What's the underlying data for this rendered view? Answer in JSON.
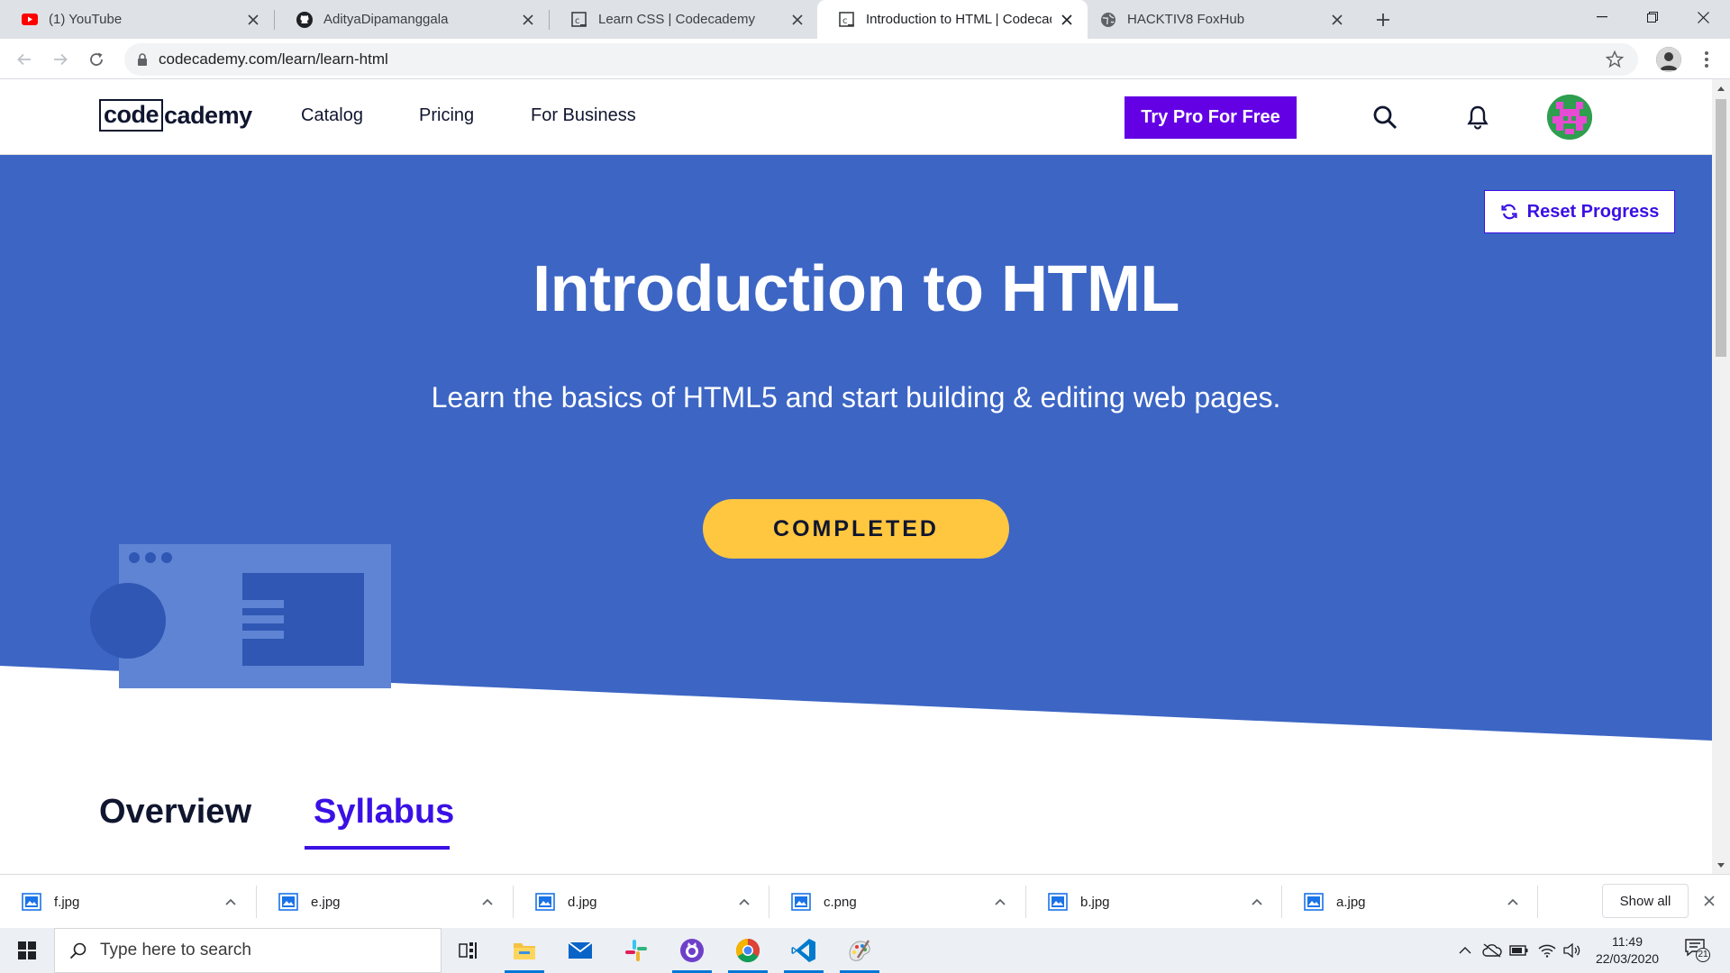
{
  "browser": {
    "tabs": [
      {
        "title": "(1) YouTube",
        "icon": "youtube-icon",
        "active": false
      },
      {
        "title": "AdityaDipamanggala",
        "icon": "github-icon",
        "active": false
      },
      {
        "title": "Learn CSS | Codecademy",
        "icon": "codecademy-icon",
        "active": false
      },
      {
        "title": "Introduction to HTML | Codecademy",
        "icon": "codecademy-icon",
        "active": true
      },
      {
        "title": "HACKTIV8 FoxHub",
        "icon": "globe-icon",
        "active": false
      }
    ],
    "url": "codecademy.com/learn/learn-html"
  },
  "site": {
    "logo_boxed": "code",
    "logo_rest": "cademy",
    "nav": [
      "Catalog",
      "Pricing",
      "For Business"
    ],
    "cta_label": "Try Pro For Free"
  },
  "hero": {
    "reset_label": "Reset Progress",
    "title": "Introduction to HTML",
    "subtitle": "Learn the basics of HTML5 and start building & editing web pages.",
    "status_label": "COMPLETED"
  },
  "content_tabs": [
    {
      "label": "Overview",
      "active": false
    },
    {
      "label": "Syllabus",
      "active": true
    }
  ],
  "downloads": {
    "files": [
      "f.jpg",
      "e.jpg",
      "d.jpg",
      "c.png",
      "b.jpg",
      "a.jpg"
    ],
    "show_all_label": "Show all"
  },
  "taskbar": {
    "search_placeholder": "Type here to search",
    "apps": [
      "task-view-icon",
      "file-explorer-icon",
      "mail-icon",
      "slack-icon",
      "github-desktop-icon",
      "chrome-icon",
      "vscode-icon",
      "paint-icon"
    ],
    "time": "11:49",
    "date": "22/03/2020",
    "notification_count": "21"
  },
  "colors": {
    "hero_blue": "#3c65c4",
    "cta_purple": "#6400e4",
    "accent_purple": "#3a10e5",
    "completed_yellow": "#ffc740"
  }
}
